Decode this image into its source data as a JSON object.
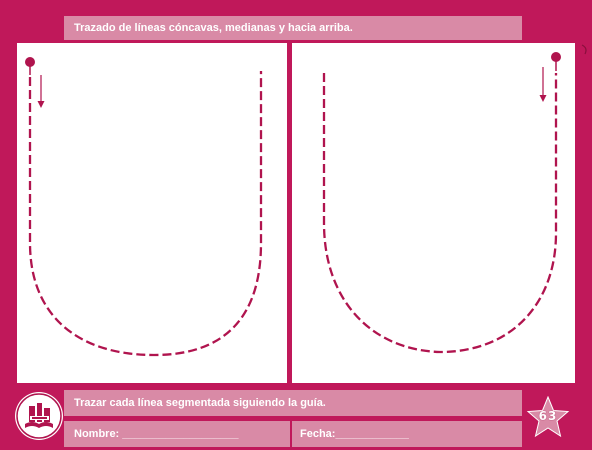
{
  "header": {
    "title": "Trazado de líneas cóncavas, medianas y hacia arriba."
  },
  "footer": {
    "instruction": "Trazar cada línea segmentada siguiendo la guía.",
    "name_field": "Nombre: ___________________",
    "date_field": "Fecha:____________",
    "page_number": "63"
  },
  "colors": {
    "background": "#c0185a",
    "bar": "#d98aa6",
    "trace": "#b0144e",
    "panel": "#ffffff"
  },
  "icons": {
    "logo": "book-logo-icon",
    "start_marker": "pin-marker-icon",
    "direction": "arrow-down-icon",
    "page_badge": "star-icon"
  }
}
